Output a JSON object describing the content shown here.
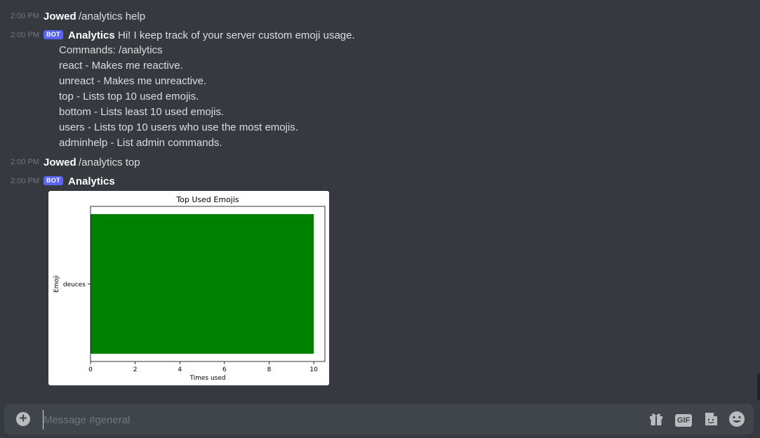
{
  "messages": [
    {
      "time": "2:00 PM",
      "author": "Jowed",
      "text": "/analytics help"
    },
    {
      "time": "2:00 PM",
      "badge": "BOT",
      "author": "Analytics",
      "text": "Hi! I keep track of your server custom emoji usage.",
      "lines": [
        "Commands: /analytics",
        "react - Makes me reactive.",
        "unreact - Makes me unreactive.",
        "top - Lists top 10 used emojis.",
        "bottom - Lists least 10 used emojis.",
        "users - Lists top 10 users who use the most emojis.",
        "adminhelp - List admin commands."
      ]
    },
    {
      "time": "2:00 PM",
      "author": "Jowed",
      "text": "/analytics top"
    },
    {
      "time": "2:00 PM",
      "badge": "BOT",
      "author": "Analytics",
      "text": ""
    }
  ],
  "chart_data": {
    "type": "bar",
    "orientation": "horizontal",
    "title": "Top Used Emojis",
    "xlabel": "Times used",
    "ylabel": "Emoji",
    "categories": [
      "deuces"
    ],
    "values": [
      10
    ],
    "xlim": [
      0,
      10.5
    ],
    "xticks": [
      "0",
      "2",
      "4",
      "6",
      "8",
      "10"
    ],
    "bar_color": "#008000"
  },
  "composer": {
    "placeholder": "Message #general",
    "icons": [
      "plus-circle-icon",
      "gift-icon",
      "gif-icon",
      "sticker-icon",
      "emoji-icon"
    ],
    "gif_label": "GIF"
  },
  "colors": {
    "background": "#36393f",
    "composer": "#40444b",
    "bot_badge": "#5865f2",
    "timestamp": "#72767d"
  }
}
